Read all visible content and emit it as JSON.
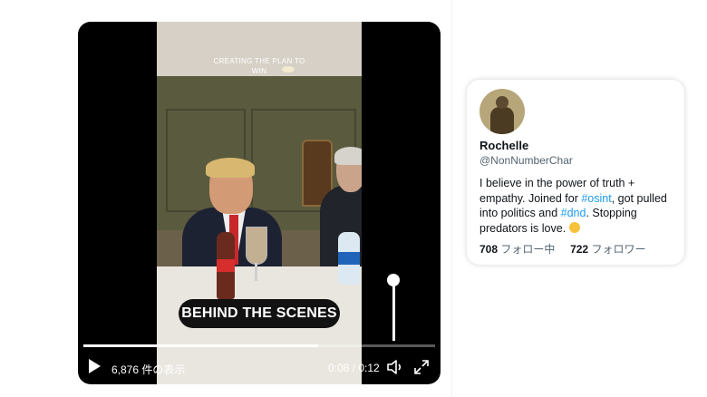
{
  "video": {
    "caption_top_line1": "CREATING THE PLAN TO",
    "caption_top_line2": "WIN",
    "caption_main": "BEHIND THE SCENES",
    "views": "6,876 件の表示",
    "time": "0:08 / 0:12",
    "progress": 0.667,
    "volume": 1.0
  },
  "profile": {
    "display_name": "Rochelle",
    "handle": "@NonNumberChar",
    "bio_part1": "I believe in the power of truth + empathy. Joined for ",
    "bio_tag1": "#osint",
    "bio_part2": ", got pulled into politics and ",
    "bio_tag2": "#dnd",
    "bio_part3": ". Stopping predators is love. ",
    "following_count": "708",
    "following_label": "フォロー中",
    "followers_count": "722",
    "followers_label": "フォロワー"
  },
  "colors": {
    "link": "#1d9bf0",
    "text_primary": "#0f1419",
    "text_secondary": "#536471"
  },
  "icons": [
    "play-icon",
    "speaker-icon",
    "expand-icon",
    "fist-emoji-icon"
  ]
}
